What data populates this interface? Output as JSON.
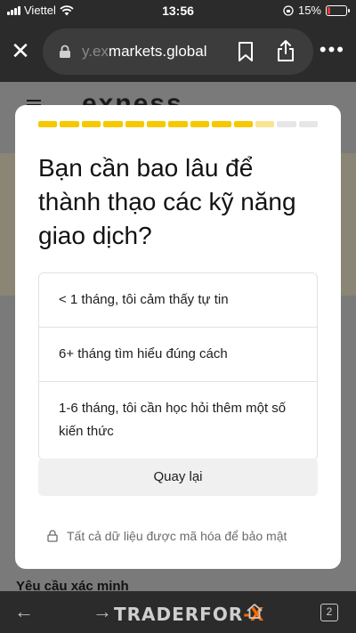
{
  "status_bar": {
    "carrier": "Viettel",
    "time": "13:56",
    "battery": "15%"
  },
  "browser": {
    "url_dim": "y.ex",
    "url_main": "markets.global",
    "close_icon": "close-icon",
    "bookmark_icon": "bookmark-icon",
    "share_icon": "share-icon",
    "more_icon": "more-icon"
  },
  "background_page": {
    "logo": "exness",
    "verification_heading": "Yêu cầu xác minh"
  },
  "modal": {
    "progress": {
      "total_steps": 13,
      "completed_steps": 10,
      "partial_steps": 1
    },
    "question": "Bạn cần bao lâu để thành thạo các kỹ năng giao dịch?",
    "options": [
      "< 1 tháng, tôi cảm thấy tự tin",
      "6+ tháng tìm hiểu đúng cách",
      "1-6 tháng, tôi cần học hỏi thêm một số kiến thức"
    ],
    "back_button": "Quay lại",
    "secure_note": "Tất cả dữ liệu được mã hóa để bảo mật",
    "accent_color": "#f5c800"
  },
  "bottom_bar": {
    "watermark_main": "TRADERFOR",
    "watermark_accent": "-X",
    "tab_count": "2"
  }
}
